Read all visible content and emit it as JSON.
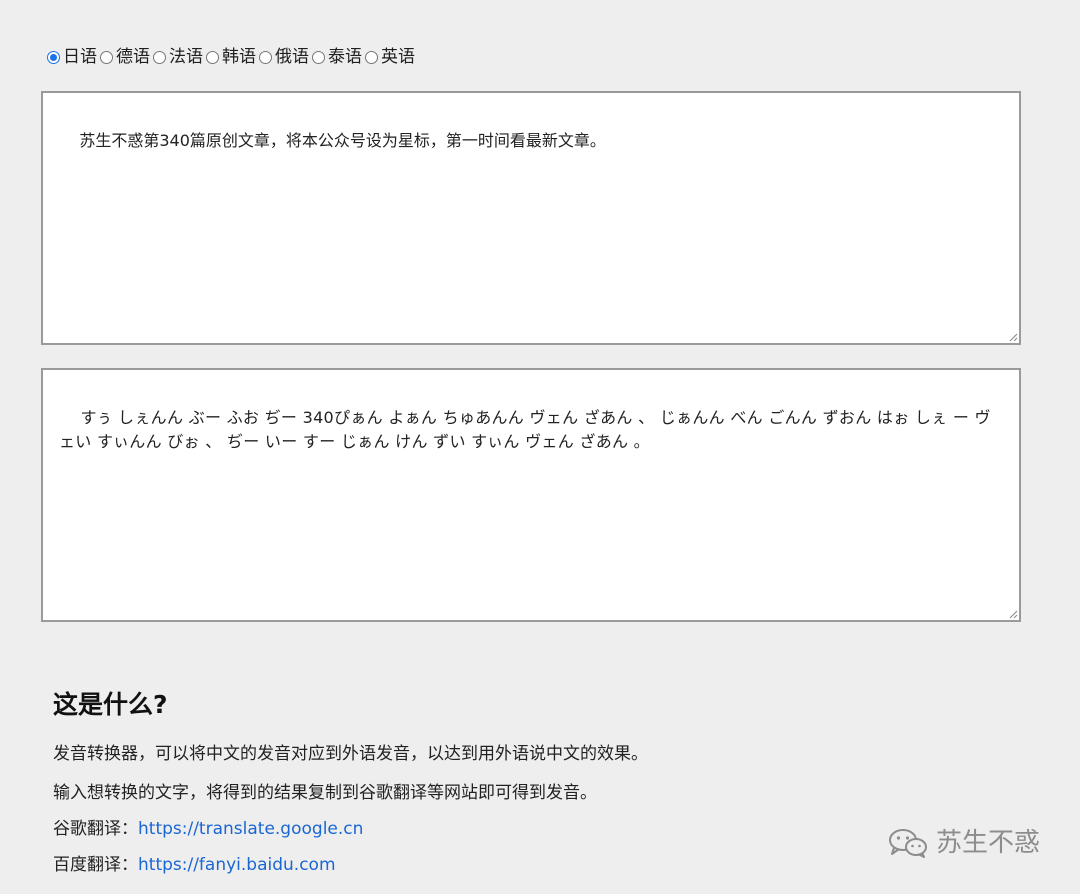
{
  "languages": {
    "selected": "日语",
    "options": [
      "日语",
      "德语",
      "法语",
      "韩语",
      "俄语",
      "泰语",
      "英语"
    ]
  },
  "input_text": "苏生不惑第340篇原创文章，将本公众号设为星标，第一时间看最新文章。",
  "output_text": "すぅ しぇんん ぶー ふお ぢー 340ぴぁん よぁん ちゅあんん ヴェん ざあん 、 じぁんん べん ごんん ずおん はぉ しぇ ー ヴェい すぃんん びぉ 、 ぢー いー すー じぁん けん ずい すぃん ヴェん ざあん 。",
  "about": {
    "title": "这是什么?",
    "line1": "发音转换器，可以将中文的发音对应到外语发音，以达到用外语说中文的效果。",
    "line2": "输入想转换的文字，将得到的结果复制到谷歌翻译等网站即可得到发音。",
    "google_label": "谷歌翻译：",
    "google_url": "https://translate.google.cn",
    "baidu_label": "百度翻译：",
    "baidu_url": "https://fanyi.baidu.com"
  },
  "watermark": {
    "icon": "wechat-icon",
    "text": "苏生不惑"
  },
  "colors": {
    "background": "#eeeeee",
    "link": "#1a66d2",
    "radio_accent": "#1a73e8"
  }
}
